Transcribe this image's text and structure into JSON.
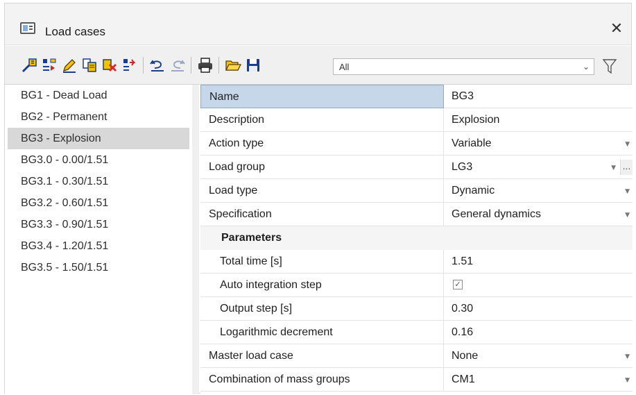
{
  "window": {
    "title": "Load cases",
    "close_glyph": "✕"
  },
  "toolbar": {
    "buttons": [
      {
        "name": "new-item-icon"
      },
      {
        "name": "insert-item-icon"
      },
      {
        "name": "edit-icon"
      },
      {
        "name": "copy-icon"
      },
      {
        "name": "delete-icon"
      },
      {
        "name": "move-item-icon"
      },
      {
        "name": "undo-icon"
      },
      {
        "name": "redo-icon"
      },
      {
        "name": "print-icon"
      },
      {
        "name": "open-folder-icon"
      },
      {
        "name": "save-icon"
      }
    ],
    "filter_value": "All",
    "filter_arrow": "⌄"
  },
  "list": {
    "items": [
      {
        "label": "BG1 - Dead Load"
      },
      {
        "label": "BG2 - Permanent"
      },
      {
        "label": "BG3 - Explosion",
        "selected": true
      },
      {
        "label": "BG3.0 - 0.00/1.51"
      },
      {
        "label": "BG3.1 - 0.30/1.51"
      },
      {
        "label": "BG3.2 - 0.60/1.51"
      },
      {
        "label": "BG3.3 - 0.90/1.51"
      },
      {
        "label": "BG3.4 - 1.20/1.51"
      },
      {
        "label": "BG3.5 - 1.50/1.51"
      }
    ]
  },
  "properties": {
    "name": {
      "label": "Name",
      "value": "BG3"
    },
    "description": {
      "label": "Description",
      "value": "Explosion"
    },
    "action_type": {
      "label": "Action type",
      "value": "Variable"
    },
    "load_group": {
      "label": "Load group",
      "value": "LG3",
      "ellipsis": "..."
    },
    "load_type": {
      "label": "Load type",
      "value": "Dynamic"
    },
    "specification": {
      "label": "Specification",
      "value": "General dynamics"
    },
    "parameters_group": {
      "label": "Parameters"
    },
    "total_time": {
      "label": "Total time [s]",
      "value": "1.51"
    },
    "auto_integration": {
      "label": "Auto integration step",
      "checked": true,
      "check_glyph": "✓"
    },
    "output_step": {
      "label": "Output step [s]",
      "value": "0.30"
    },
    "log_decrement": {
      "label": "Logarithmic decrement",
      "value": "0.16"
    },
    "master_load_case": {
      "label": "Master load case",
      "value": "None"
    },
    "mass_groups": {
      "label": "Combination of mass groups",
      "value": "CM1"
    }
  },
  "colors": {
    "selected_row": "#c5d7e8",
    "selected_list_item": "#d8d8d8",
    "toolbar_bg": "#f0f0f0"
  }
}
